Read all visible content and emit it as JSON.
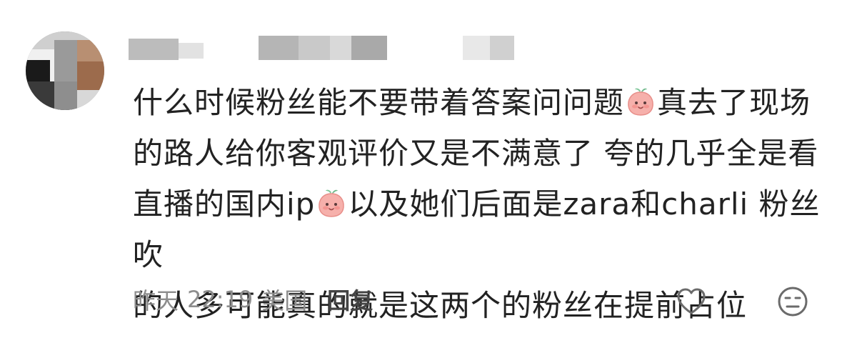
{
  "comment": {
    "lines": [
      "什么时候粉丝能不要带着答案问问题",
      "真去了现场",
      "的路人给你客观评价又是不满意了 夸的几乎全是看",
      "直播的国内ip",
      "以及她们后面是zara和charli 粉丝吹",
      "的人多可能真的就是这两个的粉丝在提前占位"
    ],
    "emoji": "peach-face-emoji"
  },
  "meta": {
    "date": "昨天",
    "time": "22:19",
    "location": "美国",
    "reply_label": "回复"
  },
  "icons": {
    "like": "heart-outline-icon",
    "dislike": "neutral-face-icon"
  },
  "colors": {
    "text": "#222222",
    "meta": "#8d8d8d",
    "reply": "#444444",
    "emoji": "#f4a3a0"
  }
}
